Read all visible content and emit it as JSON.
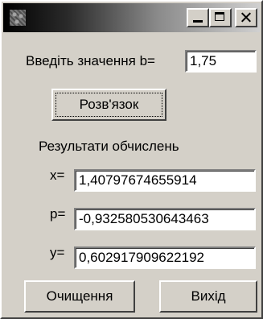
{
  "window": {
    "title": ""
  },
  "input": {
    "label": "Введіть значення b=",
    "value": "1,75"
  },
  "solve_button": {
    "label": "Розв'язок"
  },
  "results": {
    "title": "Результати обчислень",
    "x_label": "x=",
    "x_value": "1,40797674655914",
    "p_label": "p=",
    "p_value": "-0,932580530643463",
    "y_label": "y=",
    "y_value": "0,602917909622192"
  },
  "buttons": {
    "clear_label": "Очищення",
    "exit_label": "Вихід"
  }
}
